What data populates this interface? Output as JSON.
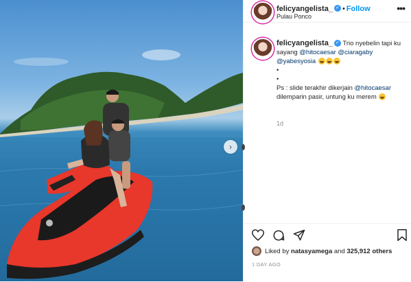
{
  "post": {
    "username": "felicyangelista_",
    "follow_label": "Follow",
    "separator": "•",
    "location": "Pulau Ponco",
    "more_label": "•••",
    "next_label": "›"
  },
  "caption": {
    "username": "felicyangelista_",
    "text_1": "Trio nyebelin tapi ku sayang",
    "mention_1": "@hitocaesar",
    "mention_2": "@ciaragaby",
    "mention_3": "@yabesyosia",
    "bullet_1": "•",
    "bullet_2": "•",
    "text_2": "Ps : slide terakhir dikerjain",
    "mention_4": "@hitocaesar",
    "text_3": "dilemparin pasir, untung ku merem",
    "time_ago": "1d"
  },
  "actions": {
    "liked_by_prefix": "Liked by",
    "liked_by_user": "natasyamega",
    "and_label": "and",
    "others_count": "325,912 others",
    "date": "1 DAY AGO"
  },
  "icons": {
    "like": "heart-icon",
    "comment": "comment-icon",
    "share": "share-icon",
    "save": "bookmark-icon",
    "verified": "verified-badge-icon"
  },
  "colors": {
    "follow": "#0095f6",
    "mention": "#00376b",
    "verified": "#3897f0",
    "jetski": "#e8372b"
  }
}
